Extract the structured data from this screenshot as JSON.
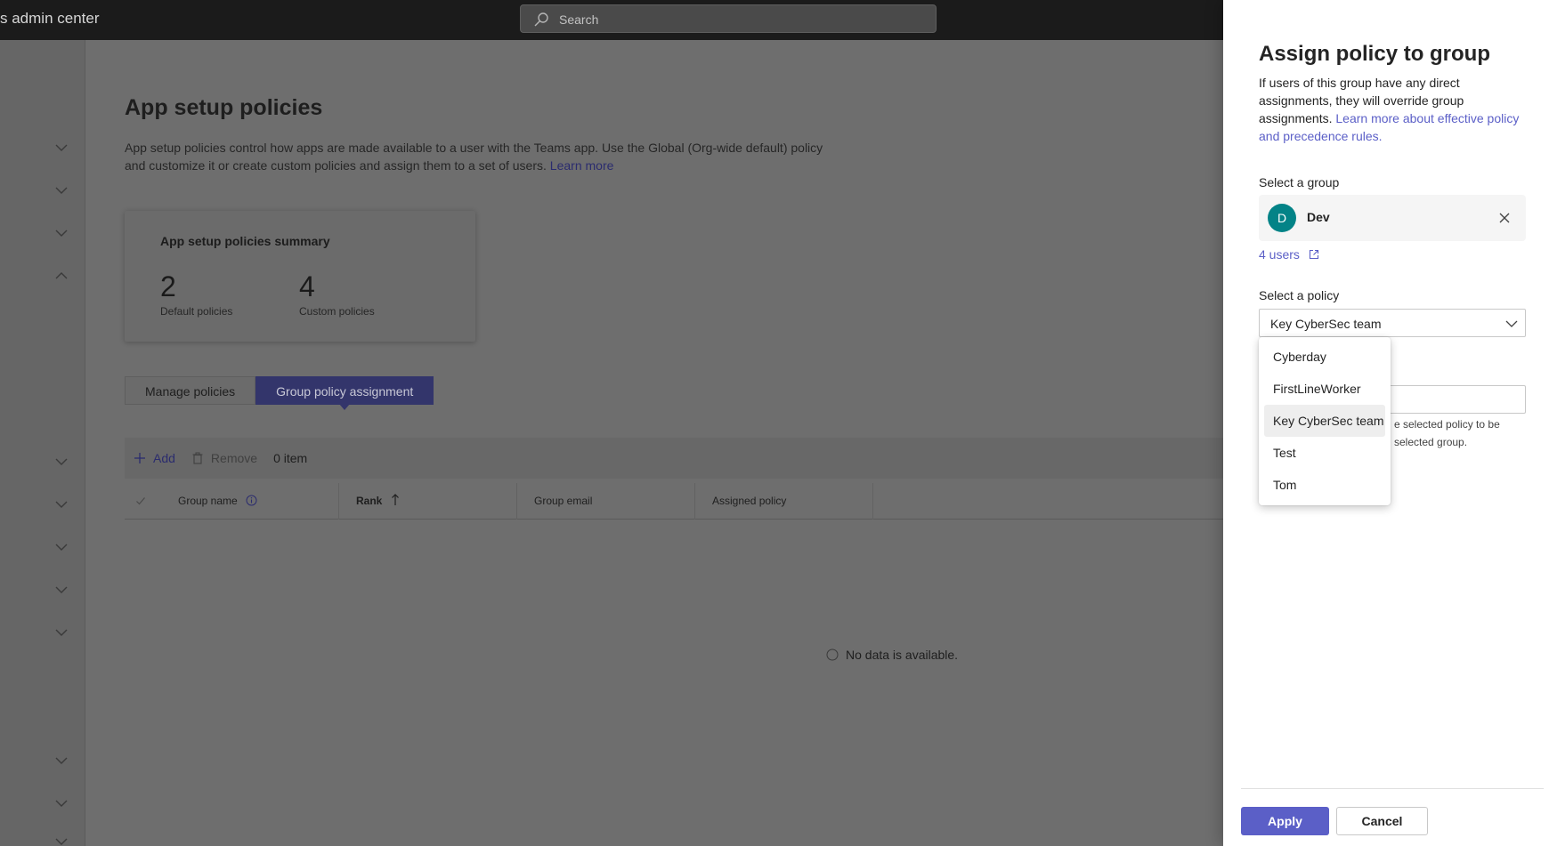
{
  "header": {
    "app_title": "s admin center",
    "search_placeholder": "Search"
  },
  "main": {
    "page_title": "App setup policies",
    "description": "App setup policies control how apps are made available to a user with the Teams app. Use the Global (Org-wide default) policy and customize it or create custom policies and assign them to a set of users.",
    "learn_more": "Learn more",
    "summary": {
      "title": "App setup policies summary",
      "default_count": "2",
      "default_label": "Default policies",
      "custom_count": "4",
      "custom_label": "Custom policies"
    },
    "tabs": [
      {
        "label": "Manage policies",
        "active": false
      },
      {
        "label": "Group policy assignment",
        "active": true
      }
    ],
    "toolbar": {
      "add_label": "Add",
      "remove_label": "Remove",
      "item_count": "0 item"
    },
    "table": {
      "columns": [
        "Group name",
        "Rank",
        "Group email",
        "Assigned policy"
      ]
    },
    "no_data": "No data is available."
  },
  "panel": {
    "title": "Assign policy to group",
    "desc": "If users of this group have any direct assignments, they will override group assignments.",
    "desc_link": "Learn more about effective policy and precedence rules.",
    "select_group_label": "Select a group",
    "group": {
      "initial": "D",
      "name": "Dev",
      "avatar_color": "#038387"
    },
    "users_link": "4 users",
    "select_policy_label": "Select a policy",
    "selected_policy": "Key CyberSec team",
    "policy_options": [
      "Cyberday",
      "FirstLineWorker",
      "Key CyberSec team",
      "Test",
      "Tom"
    ],
    "partial_help_line1": "e selected policy to be",
    "partial_help_line2": "selected group.",
    "apply_label": "Apply",
    "cancel_label": "Cancel"
  },
  "colors": {
    "accent": "#5b5fc7",
    "overlay": "#6e6e6e"
  }
}
